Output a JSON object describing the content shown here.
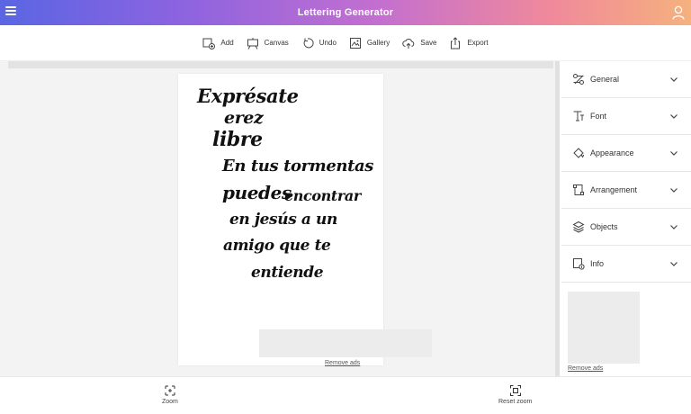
{
  "app": {
    "title": "Lettering Generator"
  },
  "toolbar": {
    "items": [
      {
        "label": "Add",
        "icon": "add-image-icon"
      },
      {
        "label": "Canvas",
        "icon": "easel-icon"
      },
      {
        "label": "Undo",
        "icon": "undo-icon"
      },
      {
        "label": "Gallery",
        "icon": "gallery-icon"
      },
      {
        "label": "Save",
        "icon": "cloud-upload-icon"
      },
      {
        "label": "Export",
        "icon": "share-icon"
      }
    ]
  },
  "lettering": {
    "lines": [
      "Exprésate",
      "erez",
      "libre",
      "En tus tormentas",
      "puedes",
      "encontrar",
      "en jesús a un",
      "amigo que te",
      "entiende"
    ]
  },
  "ads": {
    "remove_label": "Remove ads"
  },
  "panel": {
    "sections": [
      {
        "label": "General",
        "icon": "settings-sliders-icon"
      },
      {
        "label": "Font",
        "icon": "font-icon"
      },
      {
        "label": "Appearance",
        "icon": "paint-bucket-icon"
      },
      {
        "label": "Arrangement",
        "icon": "arrange-icon"
      },
      {
        "label": "Objects",
        "icon": "layers-icon"
      },
      {
        "label": "Info",
        "icon": "info-image-icon"
      }
    ],
    "remove_ads_label": "Remove ads"
  },
  "bottombar": {
    "zoom_label": "Zoom",
    "reset_zoom_label": "Reset zoom"
  },
  "colors": {
    "gradient_start": "#5a66e3",
    "gradient_end": "#f5b17e",
    "workspace_bg": "#f3f3f3"
  }
}
